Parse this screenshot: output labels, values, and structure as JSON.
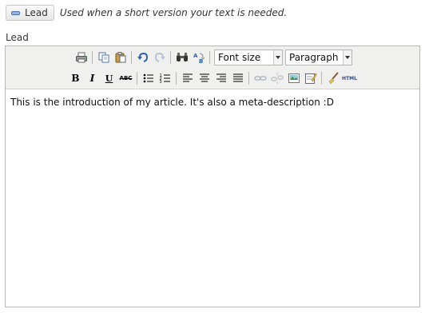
{
  "lead_toggle": {
    "label": "Lead",
    "hint": "Used when a short version your text is needed."
  },
  "field": {
    "label": "Lead"
  },
  "toolbar": {
    "font_size_value": "Font size",
    "format_value": "Paragraph",
    "bold_glyph": "B",
    "italic_glyph": "I",
    "underline_glyph": "U",
    "strike_glyph": "ABC",
    "html_glyph": "HTML"
  },
  "editor": {
    "content": "This is the introduction of my article. It's also a meta-description :D"
  }
}
